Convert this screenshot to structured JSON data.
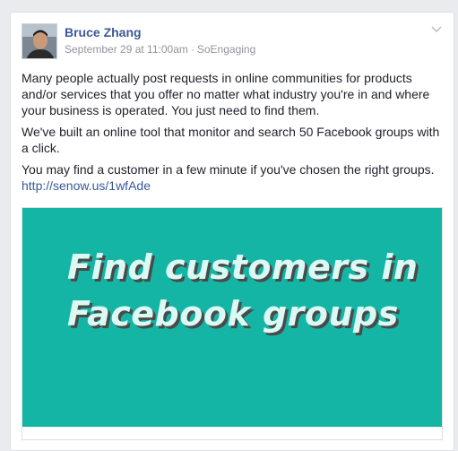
{
  "post": {
    "author": "Bruce Zhang",
    "timestamp": "September 29 at 11:00am",
    "separator": "·",
    "page": "SoEngaging",
    "paragraphs": [
      "Many people actually post requests in online communities for products and/or services that you offer no matter what industry you're in and where your business is operated. You just need to find them.",
      "We've built an online tool that monitor and search 50 Facebook groups with a click.",
      "You may find a customer in a few minute if you've chosen the right groups."
    ],
    "link": "http://senow.us/1wfAde",
    "attachment": {
      "headline_line1": "Find customers in",
      "headline_line2": "Facebook groups",
      "background_color": "#14b5a5"
    }
  },
  "icons": {
    "menu": "chevron-down-icon"
  },
  "colors": {
    "author": "#3b5998",
    "link": "#365899",
    "meta": "#90949c"
  }
}
